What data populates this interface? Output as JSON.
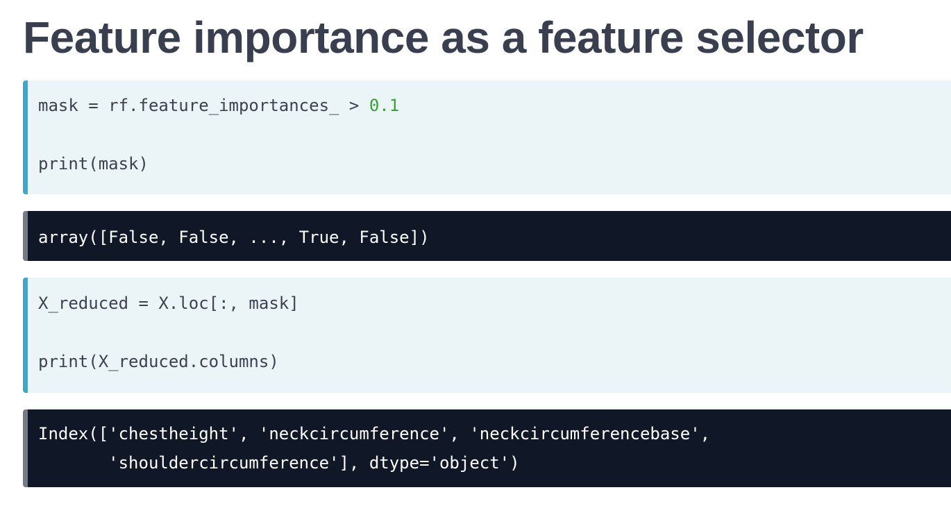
{
  "title": "Feature importance as a feature selector",
  "blocks": [
    {
      "kind": "input",
      "lines": [
        {
          "code": "mask = rf.feature_importances_ > ",
          "number": "0.1"
        },
        {
          "code": "print(mask)"
        }
      ]
    },
    {
      "kind": "output",
      "lines": [
        {
          "code": "array([False, False, ..., True, False])"
        }
      ]
    },
    {
      "kind": "input",
      "lines": [
        {
          "code": "X_reduced = X.loc[:, mask]"
        },
        {
          "code": "print(X_reduced.columns)"
        }
      ]
    },
    {
      "kind": "output",
      "lines": [
        {
          "code": "Index(['chestheight', 'neckcircumference', 'neckcircumferencebase',"
        },
        {
          "code": "       'shouldercircumference'], dtype='object')"
        }
      ]
    }
  ],
  "colors": {
    "title": "#3a3f4f",
    "input_background": "#ebf4f7",
    "input_accent": "#39aacc",
    "output_background": "#101828",
    "output_accent": "#737a83",
    "number_literal": "#34a62f"
  }
}
